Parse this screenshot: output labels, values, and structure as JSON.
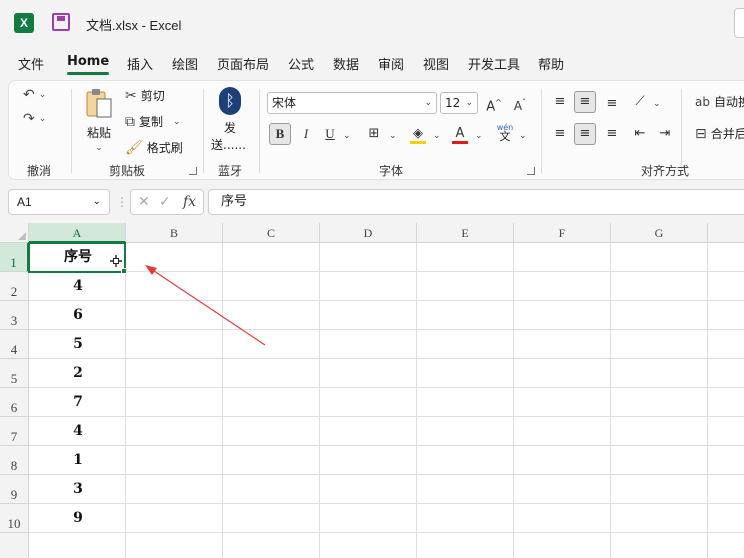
{
  "window": {
    "title": "文档.xlsx  -  Excel",
    "app_icon": "X"
  },
  "menu": {
    "tabs": [
      {
        "label": "文件"
      },
      {
        "label": "Home"
      },
      {
        "label": "插入"
      },
      {
        "label": "绘图"
      },
      {
        "label": "页面布局"
      },
      {
        "label": "公式"
      },
      {
        "label": "数据"
      },
      {
        "label": "审阅"
      },
      {
        "label": "视图"
      },
      {
        "label": "开发工具"
      },
      {
        "label": "帮助"
      }
    ],
    "active": "Home"
  },
  "ribbon": {
    "undo_group": {
      "label": "撤消"
    },
    "clipboard": {
      "paste": "粘贴",
      "cut": "剪切",
      "copy": "复制",
      "format_painter": "格式刷",
      "label": "剪贴板"
    },
    "bluetooth": {
      "send_line1": "发",
      "send_line2": "送......",
      "label": "蓝牙"
    },
    "font": {
      "name": "宋体",
      "size": "12",
      "bold": "B",
      "italic": "I",
      "underline": "U",
      "label": "字体",
      "wen_top": "wén",
      "wen_bottom": "文"
    },
    "alignment": {
      "wrap": "自动换",
      "merge": "合并后",
      "label": "对齐方式"
    }
  },
  "formula_bar": {
    "name_box": "A1",
    "fx": "fx",
    "content": "序号"
  },
  "sheet": {
    "columns": [
      "A",
      "B",
      "C",
      "D",
      "E",
      "F",
      "G"
    ],
    "rows": [
      "1",
      "2",
      "3",
      "4",
      "5",
      "6",
      "7",
      "8",
      "9",
      "10"
    ],
    "column_a_values": [
      "序号",
      "4",
      "6",
      "5",
      "2",
      "7",
      "4",
      "1",
      "3",
      "9"
    ],
    "selected_cell": "A1"
  },
  "colors": {
    "accent": "#107c41",
    "annotation_arrow": "#e53935"
  }
}
